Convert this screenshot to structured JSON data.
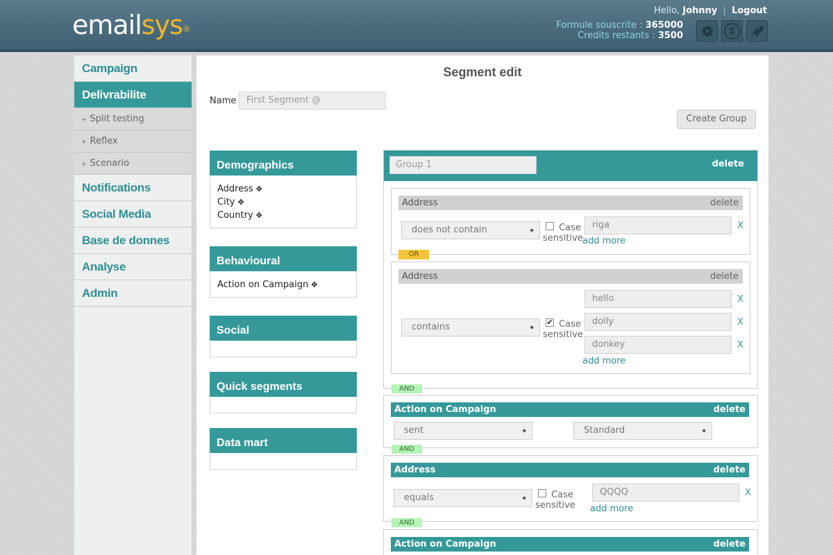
{
  "header": {
    "logo_part1": "email",
    "logo_part2": "sys",
    "logo_reg": "®",
    "hello": "Hello,",
    "user": "Johnny",
    "separator": "|",
    "logout": "Logout",
    "formule_label": "Formule souscrite :",
    "formule_value": "365000",
    "credits_label": "Credits restants :",
    "credits_value": "3500",
    "icons": [
      "gear-icon",
      "dollar-icon",
      "rocket-icon"
    ]
  },
  "sidebar": {
    "items": [
      {
        "label": "Campaign"
      },
      {
        "label": "Delivrabilite"
      },
      {
        "label": "Notifications"
      },
      {
        "label": "Social Media"
      },
      {
        "label": "Base de donnes"
      },
      {
        "label": "Analyse"
      },
      {
        "label": "Admin"
      }
    ],
    "sub_items": [
      {
        "label": "Split testing"
      },
      {
        "label": "Reflex"
      },
      {
        "label": "Scenario"
      }
    ],
    "bullet": "+"
  },
  "main": {
    "title": "Segment edit",
    "name_label": "Name",
    "name_value": "First Segment @",
    "create_group": "Create Group"
  },
  "panels": {
    "demographics": {
      "title": "Demographics",
      "items": [
        "Address",
        "City",
        "Country"
      ]
    },
    "behavioural": {
      "title": "Behavioural",
      "items": [
        "Action on Campaign"
      ]
    },
    "social": {
      "title": "Social"
    },
    "quick": {
      "title": "Quick segments"
    },
    "datamart": {
      "title": "Data mart"
    },
    "plus": "✥"
  },
  "group1": {
    "name_placeholder": "Group 1",
    "delete": "delete",
    "cond1": {
      "field": "Address",
      "delete": "delete",
      "operator": "does not contain",
      "case_label_1": "Case",
      "case_label_2": "sensitive",
      "values": [
        "riga"
      ],
      "x": "X",
      "add_more": "add more"
    },
    "or_label": "OR",
    "cond2": {
      "field": "Address",
      "delete": "delete",
      "operator": "contains",
      "case_label_1": "Case",
      "case_label_2": "sensitive",
      "case_checked": "✔",
      "values": [
        "hello",
        "dolly",
        "donkey"
      ],
      "x": "X",
      "add_more": "add more"
    }
  },
  "and_label": "AND",
  "card_action1": {
    "title": "Action on Campaign",
    "delete": "delete",
    "select1": "sent",
    "select2": "Standard"
  },
  "card_address": {
    "title": "Address",
    "delete": "delete",
    "operator": "equals",
    "case_label_1": "Case",
    "case_label_2": "sensitive",
    "value": "QQQQ",
    "x": "X",
    "add_more": "add more"
  },
  "card_action2": {
    "title": "Action on Campaign",
    "delete": "delete"
  },
  "select_arrow": "⬥"
}
